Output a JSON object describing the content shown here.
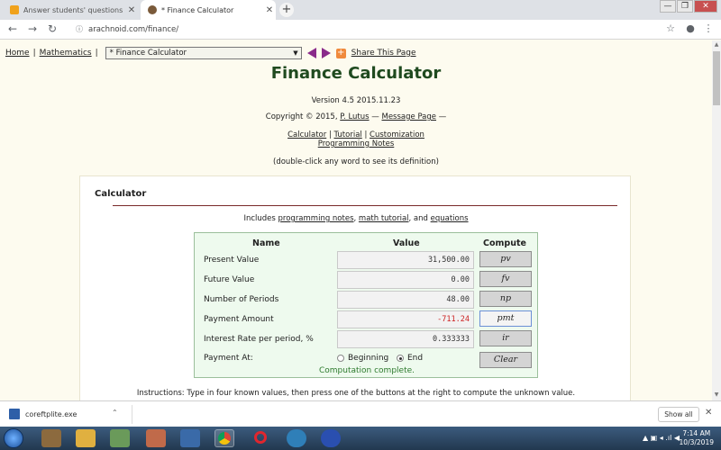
{
  "browser": {
    "tabs": [
      {
        "title": "Answer students' questions and ..."
      },
      {
        "title": "* Finance Calculator"
      }
    ],
    "url": "arachnoid.com/finance/"
  },
  "nav": {
    "home": "Home",
    "mathematics": "Mathematics",
    "select_value": "* Finance Calculator",
    "share": "Share This Page"
  },
  "header": {
    "title": "Finance Calculator",
    "version": "Version 4.5 2015.11.23",
    "copyright_prefix": "Copyright © 2015,",
    "author": "P. Lutus",
    "dash1": "—",
    "message_page": "Message Page",
    "dash2": "—",
    "links": {
      "calculator": "Calculator",
      "tutorial": "Tutorial",
      "customization": "Customization",
      "programming_notes": "Programming Notes",
      "sep": "|"
    },
    "hint": "(double-click any word to see its definition)"
  },
  "panel": {
    "title": "Calculator",
    "includes_prefix": "Includes",
    "includes_link1": "programming notes",
    "includes_comma": ",",
    "includes_link2": "math tutorial",
    "includes_and": ", and",
    "includes_link3": "equations"
  },
  "calculator": {
    "headers": {
      "name": "Name",
      "value": "Value",
      "compute": "Compute"
    },
    "rows": [
      {
        "name": "Present Value",
        "value": "31,500.00",
        "button": "pv"
      },
      {
        "name": "Future Value",
        "value": "0.00",
        "button": "fv"
      },
      {
        "name": "Number of Periods",
        "value": "48.00",
        "button": "np"
      },
      {
        "name": "Payment Amount",
        "value": "-711.24",
        "button": "pmt"
      },
      {
        "name": "Interest Rate per period, %",
        "value": "0.333333",
        "button": "ir"
      }
    ],
    "payment_at": {
      "label": "Payment At:",
      "options": [
        "Beginning",
        "End"
      ],
      "selected": "End"
    },
    "clear_label": "Clear",
    "status": "Computation complete."
  },
  "instructions": "Instructions: Type in four known values, then press one of the buttons at the right to compute the unknown value.",
  "download_bar": {
    "filename": "coreftplite.exe",
    "show_all": "Show all"
  },
  "taskbar": {
    "time": "7:14 AM",
    "date": "10/3/2019"
  },
  "colors": {
    "title_green": "#1f4a1f",
    "calc_bg": "#eefaee",
    "negative_red": "#cc2222",
    "status_green": "#2d7a2d",
    "nav_arrow_purple": "#8a2b8a"
  }
}
